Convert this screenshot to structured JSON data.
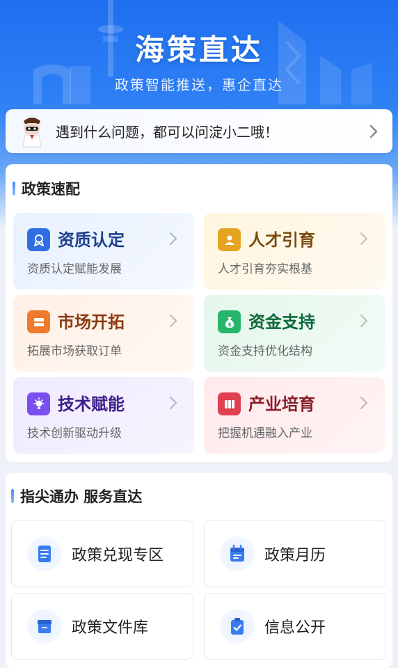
{
  "header": {
    "title": "海策直达",
    "subtitle": "政策智能推送，惠企直达"
  },
  "assistant": {
    "prompt": "遇到什么问题，都可以问淀小二哦！"
  },
  "policy_match": {
    "section_title": "政策速配",
    "items": [
      {
        "title": "资质认定",
        "desc": "资质认定赋能发展",
        "icon": "certificate-icon",
        "color": "#2f6fe4"
      },
      {
        "title": "人才引育",
        "desc": "人才引育夯实根基",
        "icon": "talent-icon",
        "color": "#e6a320"
      },
      {
        "title": "市场开拓",
        "desc": "拓展市场获取订单",
        "icon": "market-icon",
        "color": "#f07a2c"
      },
      {
        "title": "资金支持",
        "desc": "资金支持优化结构",
        "icon": "money-bag-icon",
        "color": "#27b56b"
      },
      {
        "title": "技术赋能",
        "desc": "技术创新驱动升级",
        "icon": "lightbulb-icon",
        "color": "#7a4ff0"
      },
      {
        "title": "产业培育",
        "desc": "把握机遇融入产业",
        "icon": "industry-icon",
        "color": "#e0404f"
      }
    ]
  },
  "services": {
    "section_title": "指尖通办 服务直达",
    "items": [
      {
        "label": "政策兑现专区",
        "icon": "document-icon"
      },
      {
        "label": "政策月历",
        "icon": "calendar-icon"
      },
      {
        "label": "政策文件库",
        "icon": "archive-box-icon"
      },
      {
        "label": "信息公开",
        "icon": "clipboard-check-icon"
      }
    ]
  },
  "colors": {
    "primary_blue": "#1e6ff0",
    "title_blue": "#1c3f8c",
    "title_gold": "#7a4a10",
    "title_orange": "#8a3a12",
    "title_green": "#0f6a3c",
    "title_purple": "#3c1f8a",
    "title_red": "#8a1f2a"
  }
}
